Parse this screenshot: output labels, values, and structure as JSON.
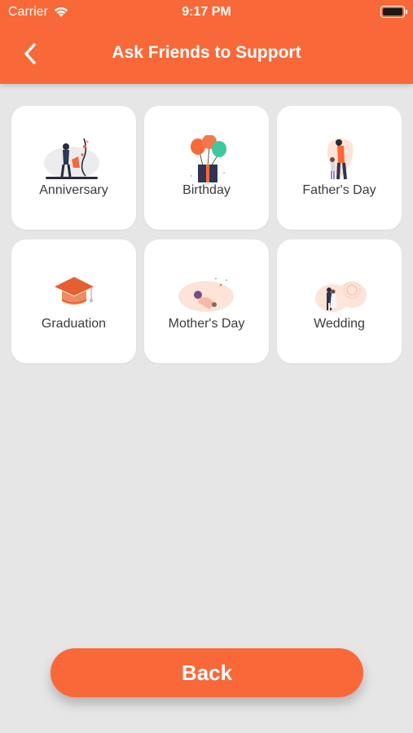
{
  "status_bar": {
    "carrier": "Carrier",
    "time": "9:17 PM"
  },
  "header": {
    "title": "Ask Friends to Support",
    "back_icon": "chevron-left-icon"
  },
  "occasions": [
    {
      "label": "Anniversary",
      "icon": "anniversary-illustration"
    },
    {
      "label": "Birthday",
      "icon": "birthday-balloons-illustration"
    },
    {
      "label": "Father's Day",
      "icon": "fathers-day-illustration"
    },
    {
      "label": "Graduation",
      "icon": "graduation-cap-illustration"
    },
    {
      "label": "Mother's Day",
      "icon": "mothers-day-illustration"
    },
    {
      "label": "Wedding",
      "icon": "wedding-illustration"
    }
  ],
  "footer": {
    "back_label": "Back"
  },
  "colors": {
    "accent": "#f96838",
    "background": "#e6e6e6",
    "card": "#ffffff"
  }
}
